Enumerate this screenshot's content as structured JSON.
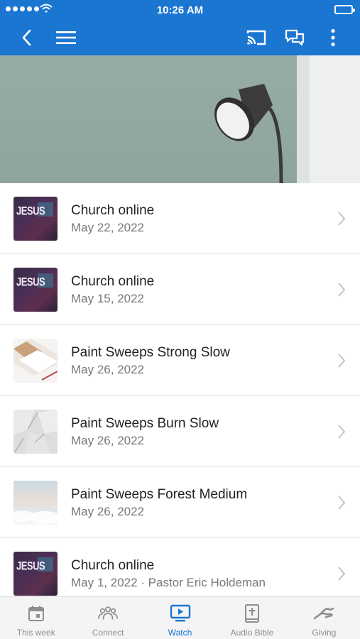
{
  "status_bar": {
    "time": "10:26 AM"
  },
  "nav": {
    "back_icon": "chevron-left-icon",
    "menu_icon": "hamburger-icon",
    "cast_icon": "cast-icon",
    "chat_icon": "chat-icon",
    "more_icon": "kebab-icon"
  },
  "colors": {
    "brand": "#1b76d2",
    "tab_inactive": "#8e8e8e"
  },
  "items": [
    {
      "title": "Church online",
      "subtitle": "May 22, 2022",
      "thumb": "jesus",
      "thumb_text": "JESUS"
    },
    {
      "title": "Church online",
      "subtitle": "May 15, 2022",
      "thumb": "jesus",
      "thumb_text": "JESUS"
    },
    {
      "title": "Paint Sweeps Strong Slow",
      "subtitle": "May 26, 2022",
      "thumb": "swatch"
    },
    {
      "title": "Paint Sweeps Burn Slow",
      "subtitle": "May 26, 2022",
      "thumb": "shards"
    },
    {
      "title": "Paint Sweeps Forest Medium",
      "subtitle": "May 26, 2022",
      "thumb": "clouds"
    },
    {
      "title": "Church online",
      "subtitle": "May 1, 2022 · Pastor Eric Holdeman",
      "thumb": "jesus",
      "thumb_text": "JESUS"
    }
  ],
  "tabs": [
    {
      "label": "This week",
      "icon": "calendar-icon",
      "active": false
    },
    {
      "label": "Connect",
      "icon": "people-icon",
      "active": false
    },
    {
      "label": "Watch",
      "icon": "tv-play-icon",
      "active": true
    },
    {
      "label": "Audio Bible",
      "icon": "bible-icon",
      "active": false
    },
    {
      "label": "Giving",
      "icon": "giving-hand-icon",
      "active": false
    }
  ]
}
